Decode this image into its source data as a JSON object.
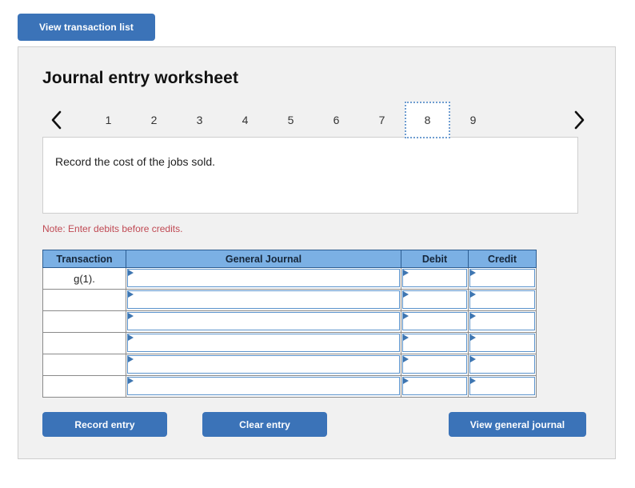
{
  "toolbar": {
    "view_transaction_list_label": "View transaction list"
  },
  "panel": {
    "title": "Journal entry worksheet",
    "pager": {
      "prev_icon": "chevron-left-icon",
      "next_icon": "chevron-right-icon",
      "tabs": [
        "1",
        "2",
        "3",
        "4",
        "5",
        "6",
        "7",
        "8",
        "9"
      ],
      "active_tab": "8"
    },
    "description": "Record the cost of the jobs sold.",
    "note": "Note: Enter debits before credits.",
    "table": {
      "headers": {
        "transaction": "Transaction",
        "general_journal": "General Journal",
        "debit": "Debit",
        "credit": "Credit"
      },
      "rows": [
        {
          "transaction": "g(1).",
          "general_journal": "",
          "debit": "",
          "credit": ""
        },
        {
          "transaction": "",
          "general_journal": "",
          "debit": "",
          "credit": ""
        },
        {
          "transaction": "",
          "general_journal": "",
          "debit": "",
          "credit": ""
        },
        {
          "transaction": "",
          "general_journal": "",
          "debit": "",
          "credit": ""
        },
        {
          "transaction": "",
          "general_journal": "",
          "debit": "",
          "credit": ""
        },
        {
          "transaction": "",
          "general_journal": "",
          "debit": "",
          "credit": ""
        }
      ]
    },
    "actions": {
      "record_entry_label": "Record entry",
      "clear_entry_label": "Clear entry",
      "view_general_journal_label": "View general journal"
    }
  },
  "colors": {
    "button_blue": "#3b73b8",
    "table_header_blue": "#7bb0e4",
    "note_red": "#c04a54",
    "panel_gray": "#f1f1f1",
    "panel_border": "#cfcfcf",
    "field_border_blue": "#5b93cc"
  }
}
